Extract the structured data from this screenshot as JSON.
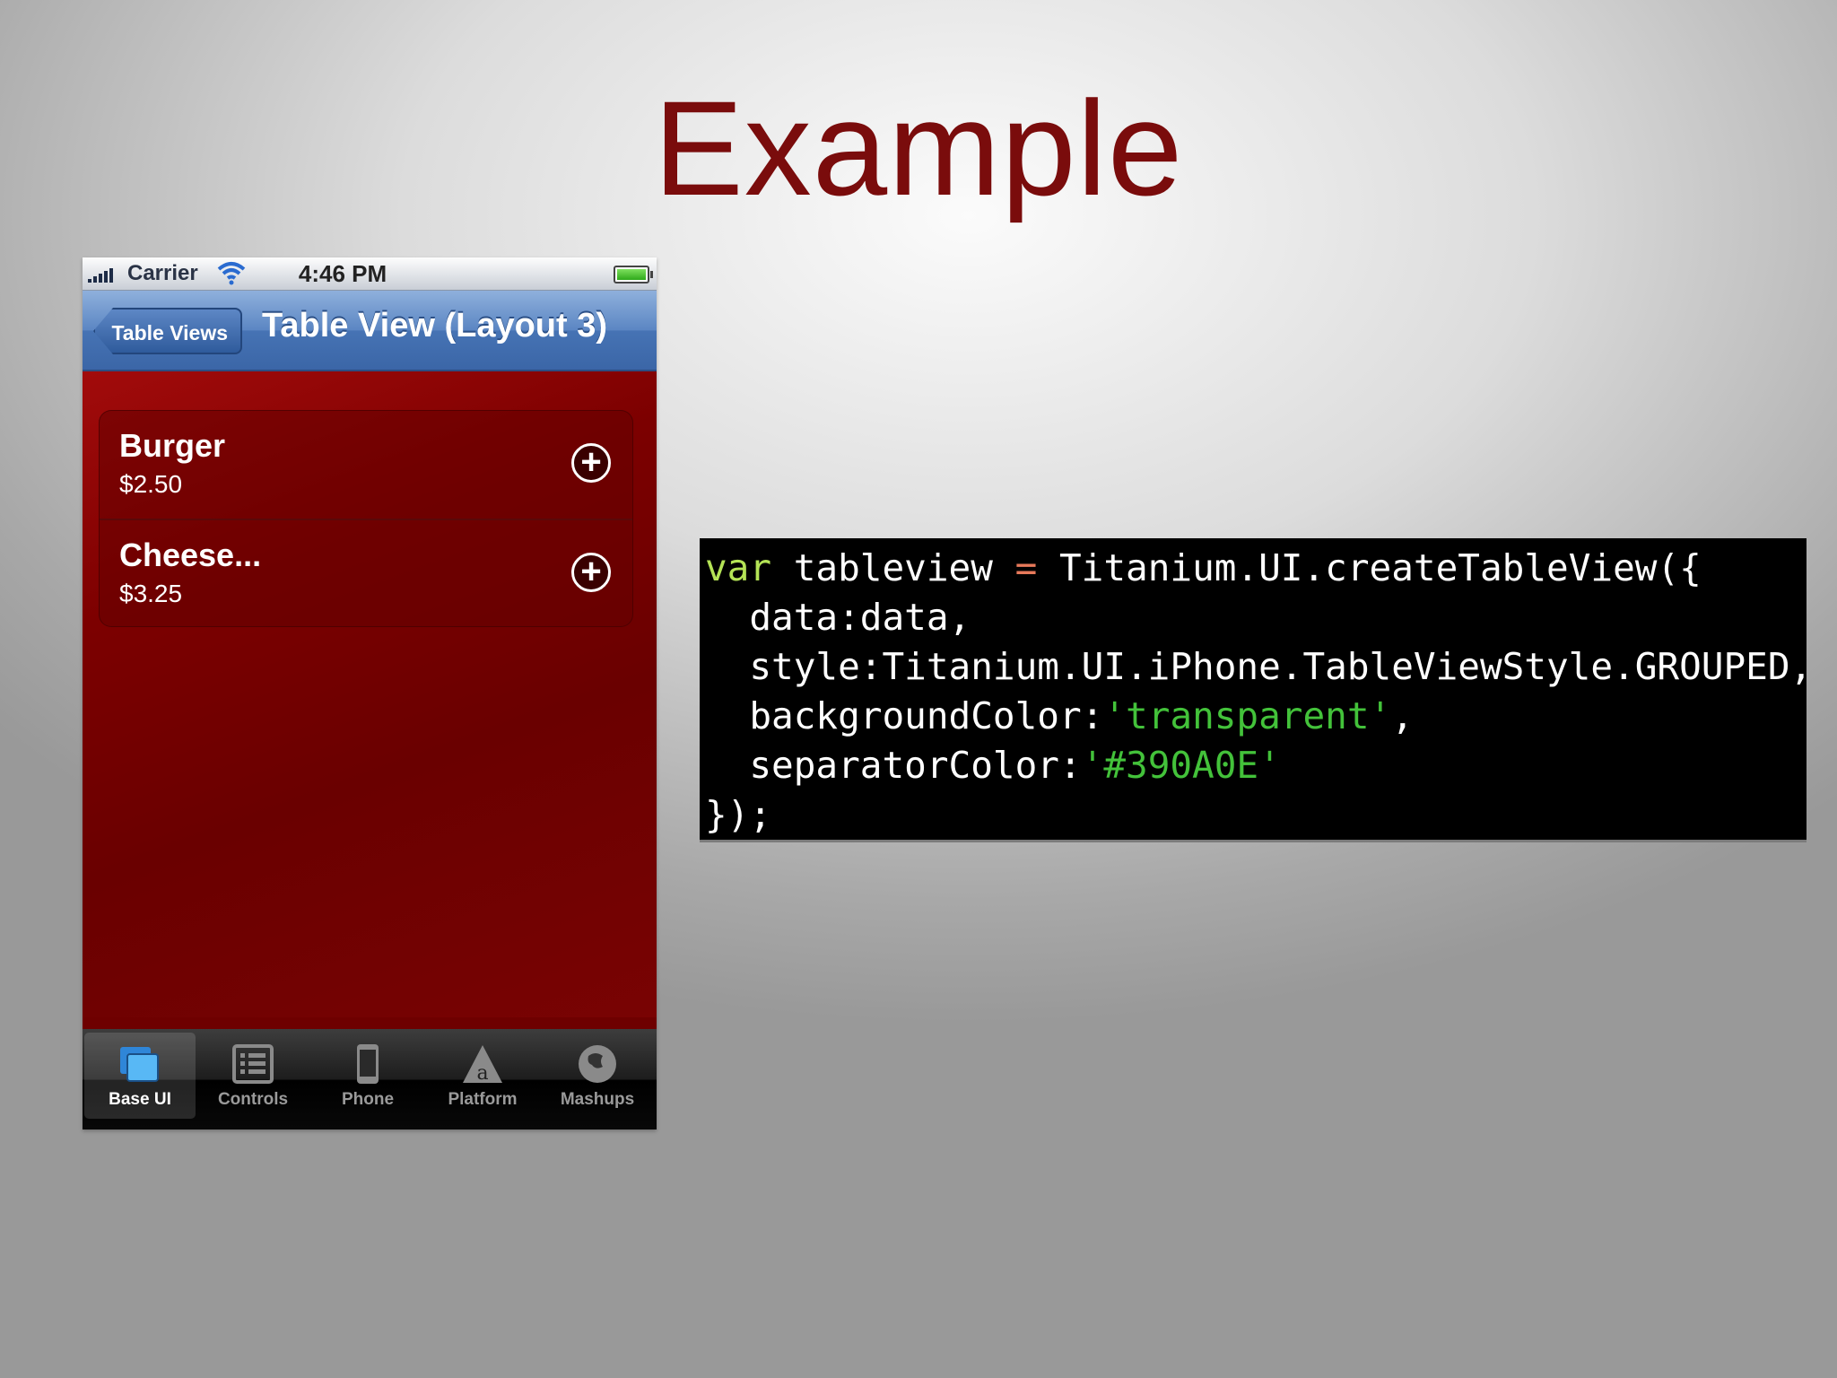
{
  "slide": {
    "title": "Example"
  },
  "status_bar": {
    "carrier": "Carrier",
    "time": "4:46 PM"
  },
  "nav_bar": {
    "back_label": "Table Views",
    "title": "Table View (Layout 3)"
  },
  "table": {
    "rows": [
      {
        "name": "Burger",
        "price": "$2.50"
      },
      {
        "name": "Cheese...",
        "price": "$3.25"
      }
    ],
    "add_glyph": "+"
  },
  "tab_bar": {
    "tabs": [
      {
        "label": "Base UI",
        "icon": "base-ui-icon",
        "active": true
      },
      {
        "label": "Controls",
        "icon": "controls-icon",
        "active": false
      },
      {
        "label": "Phone",
        "icon": "phone-icon",
        "active": false
      },
      {
        "label": "Platform",
        "icon": "platform-icon",
        "active": false
      },
      {
        "label": "Mashups",
        "icon": "mashups-icon",
        "active": false
      }
    ]
  },
  "code": {
    "l1_kw": "var",
    "l1_a": " tableview ",
    "l1_op": "=",
    "l1_b": " Titanium.UI.createTableView({",
    "l2": "  data:data,",
    "l3": "  style:Titanium.UI.iPhone.TableViewStyle.GROUPED,",
    "l4_a": "  backgroundColor:",
    "l4_str": "'transparent'",
    "l4_b": ",",
    "l5_a": "  separatorColor:",
    "l5_str": "'#390A0E'",
    "l6": "});"
  },
  "colors": {
    "title": "#7a0c0c",
    "phone_background": "#6e0000",
    "separator": "#390A0E",
    "code_keyword": "#b4e356",
    "code_string": "#43c23a"
  }
}
